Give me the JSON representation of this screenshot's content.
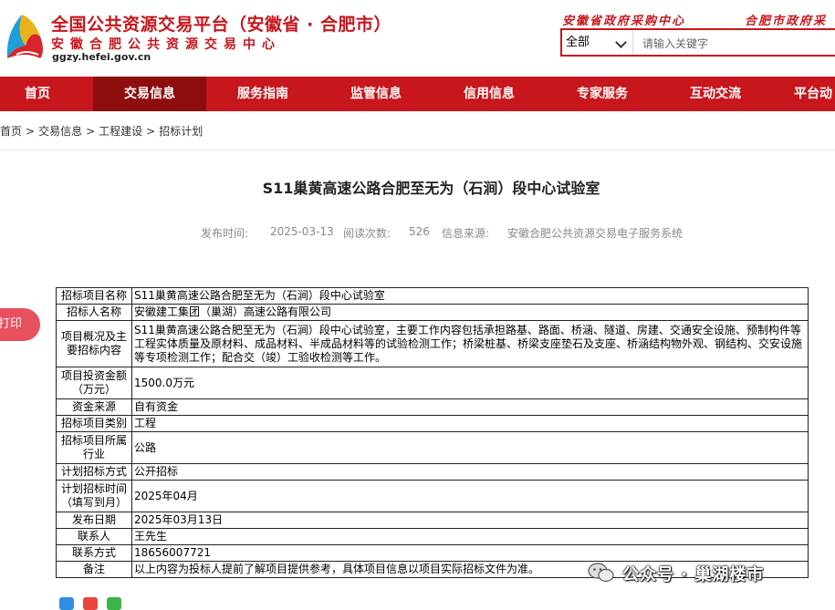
{
  "header": {
    "site_title": "全国公共资源交易平台（安徽省 · 合肥市）",
    "site_subtitle": "安徽合肥公共资源交易中心",
    "site_url": "ggzy.hefei.gov.cn",
    "link_province": "安徽省政府采购中心",
    "link_city": "合肥市政府采",
    "search": {
      "category": "全部",
      "placeholder": "请输入关键字"
    }
  },
  "nav": [
    {
      "label": "首页"
    },
    {
      "label": "交易信息",
      "active": true
    },
    {
      "label": "服务指南"
    },
    {
      "label": "监管信息"
    },
    {
      "label": "信用信息"
    },
    {
      "label": "专家服务"
    },
    {
      "label": "互动交流"
    },
    {
      "label": "平台动"
    }
  ],
  "breadcrumb": [
    "首页",
    "交易信息",
    "工程建设",
    "招标计划"
  ],
  "article": {
    "title": "S11巢黄高速公路合肥至无为（石涧）段中心试验室",
    "publish_time_label": "发布时间:",
    "publish_time": "2025-03-13",
    "views_label": "阅读次数:",
    "views": "526",
    "source_label": "信息来源:",
    "source": "安徽合肥公共资源交易电子服务系统"
  },
  "print_label": "打印",
  "table": [
    {
      "label": "招标项目名称",
      "value": "S11巢黄高速公路合肥至无为（石涧）段中心试验室"
    },
    {
      "label": "招标人名称",
      "value": "安徽建工集团（巢湖）高速公路有限公司"
    },
    {
      "label": "项目概况及主要招标内容",
      "value": "S11巢黄高速公路合肥至无为（石涧）段中心试验室，主要工作内容包括承担路基、路面、桥涵、隧道、房建、交通安全设施、预制构件等工程实体质量及原材料、成品材料、半成品材料等的试验检测工作；桥梁桩基、桥梁支座垫石及支座、桥涵结构物外观、钢结构、交安设施等专项检测工作；配合交（竣）工验收检测等工作。"
    },
    {
      "label": "项目投资金额（万元）",
      "value": "1500.0万元"
    },
    {
      "label": "资金来源",
      "value": "自有资金"
    },
    {
      "label": "招标项目类别",
      "value": "工程"
    },
    {
      "label": "招标项目所属行业",
      "value": "公路"
    },
    {
      "label": "计划招标方式",
      "value": "公开招标"
    },
    {
      "label": "计划招标时间（填写到月）",
      "value": "2025年04月"
    },
    {
      "label": "发布日期",
      "value": "2025年03月13日"
    },
    {
      "label": "联系人",
      "value": "王先生"
    },
    {
      "label": "联系方式",
      "value": "18656007721"
    },
    {
      "label": "备注",
      "value": "以上内容为投标人提前了解项目提供参考，具体项目信息以项目实际招标文件为准。"
    }
  ],
  "watermark": "公众号 · 巢湖楼市",
  "colors": {
    "brand_red": "#c8161d",
    "nav_active": "#8e0e0e",
    "print_pink": "#e9505e"
  },
  "icons": [
    "emblem-logo",
    "chevron-down-icon",
    "share-qzone-icon",
    "share-weibo-icon",
    "share-wechat-icon",
    "wechat-icon"
  ]
}
